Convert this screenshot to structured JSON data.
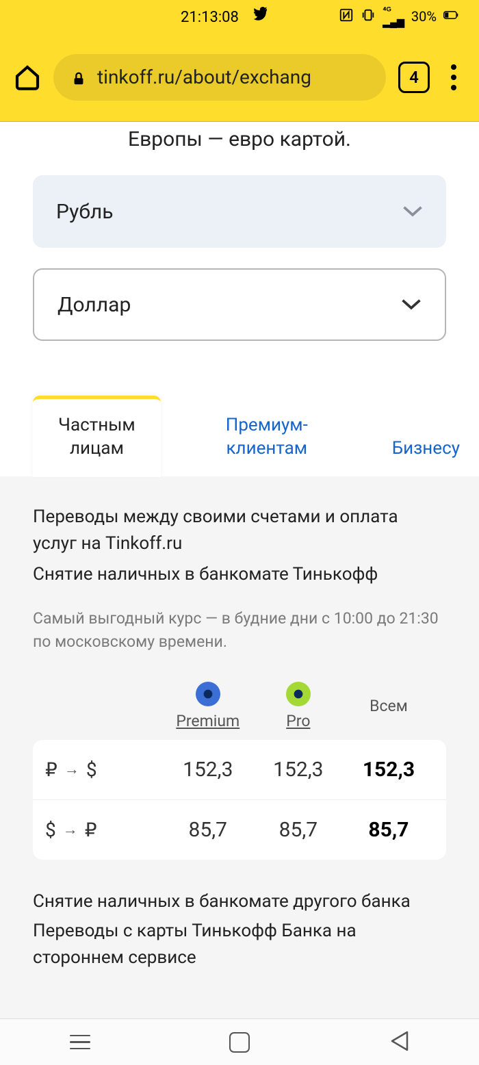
{
  "status": {
    "time": "21:13:08",
    "battery": "30%"
  },
  "browser": {
    "url": "tinkoff.ru/about/exchang",
    "tab_count": "4"
  },
  "page": {
    "subtitle": "Европы — евро картой.",
    "select_from": "Рубль",
    "select_to": "Доллар"
  },
  "tabs": {
    "personal": "Частным лицам",
    "premium": "Премиум-клиентам",
    "business": "Бизнесу"
  },
  "section": {
    "desc1": "Переводы между своими счетами и оплата услуг на Tinkoff.ru",
    "desc2": "Снятие наличных в банкомате Тинькофф",
    "fine": "Самый выгодный курс — в будние дни с 10:00 до 21:30 по московскому времени.",
    "after1": "Снятие наличных в банкомате другого банка",
    "after2": "Переводы с карты Тинькофф Банка на стороннем сервисе"
  },
  "rates": {
    "head_premium": "Premium",
    "head_pro": "Pro",
    "head_all": "Всем",
    "rows": [
      {
        "label_from": "₽",
        "label_to": "$",
        "premium": "152,3",
        "pro": "152,3",
        "all": "152,3"
      },
      {
        "label_from": "$",
        "label_to": "₽",
        "premium": "85,7",
        "pro": "85,7",
        "all": "85,7"
      }
    ]
  }
}
